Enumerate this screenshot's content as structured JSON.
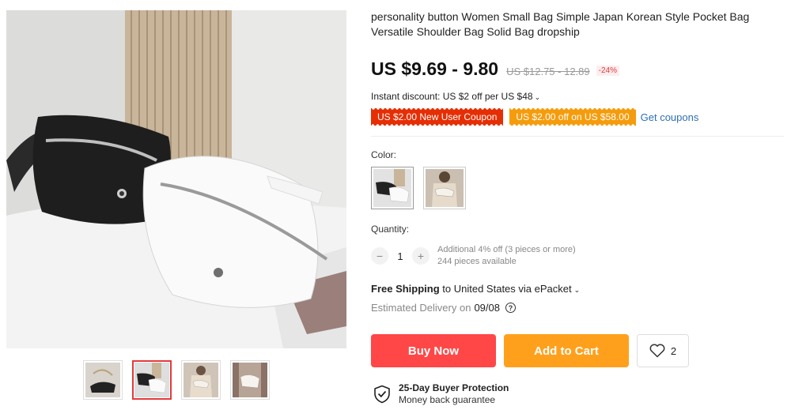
{
  "product": {
    "title": "personality button Women Small Bag Simple Japan Korean Style Pocket Bag Versatile Shoulder Bag Solid Bag dropship",
    "price_current": "US $9.69 - 9.80",
    "price_original": "US $12.75 - 12.89",
    "discount_badge": "-24%"
  },
  "instant_discount": {
    "text": "Instant discount: US $2 off per US $48",
    "chevron": "chevron-down-icon"
  },
  "coupons": {
    "new_user": "US $2.00 New User Coupon",
    "store": "US $2.00 off on US $58.00",
    "get_link": "Get coupons"
  },
  "color": {
    "label": "Color:",
    "options": [
      "black-and-white-bags",
      "beige-bag-on-model"
    ],
    "selected_index": 0
  },
  "quantity": {
    "label": "Quantity:",
    "value": "1",
    "minus": "−",
    "plus": "+",
    "note": "Additional 4% off (3 pieces or more)",
    "available": "244 pieces available"
  },
  "shipping": {
    "label": "Free Shipping",
    "detail": " to United States via ePacket",
    "delivery_label": "Estimated Delivery on",
    "delivery_date": "09/08",
    "help_glyph": "?"
  },
  "actions": {
    "buy_now": "Buy Now",
    "add_to_cart": "Add to Cart",
    "wishlist_count": "2"
  },
  "protection": {
    "title": "25-Day Buyer Protection",
    "subtitle": "Money back guarantee"
  },
  "gallery": {
    "thumbnails": [
      "bag-chain-strap",
      "black-and-white-bags",
      "beige-bag-on-model",
      "white-bag-on-model"
    ],
    "active_index": 1
  },
  "colors": {
    "buy_now": "#ff4747",
    "add_to_cart": "#ffa01c",
    "coupon_red": "#e62e04",
    "coupon_orange": "#f59c0d",
    "link": "#2e6fb8"
  }
}
